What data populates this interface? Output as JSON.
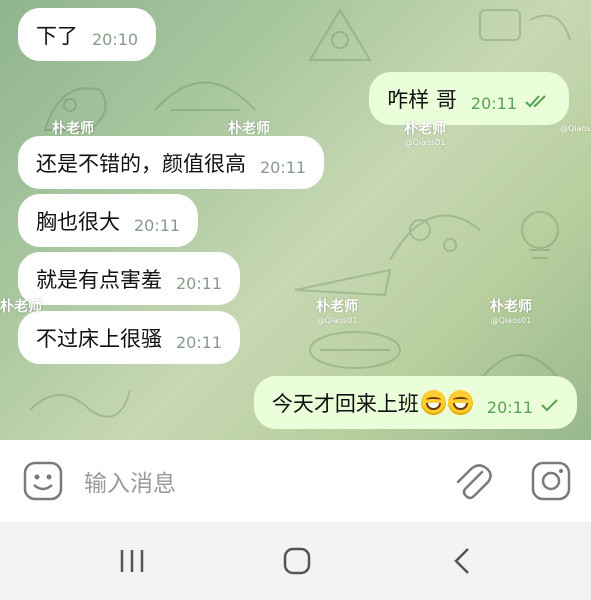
{
  "messages": [
    {
      "text": "下了",
      "time": "20:10",
      "direction": "incoming"
    },
    {
      "text": "咋样 哥",
      "time": "20:11",
      "direction": "outgoing",
      "status": "read"
    },
    {
      "text": "还是不错的，颜值很高",
      "time": "20:11",
      "direction": "incoming"
    },
    {
      "text": "胸也很大",
      "time": "20:11",
      "direction": "incoming"
    },
    {
      "text": "就是有点害羞",
      "time": "20:11",
      "direction": "incoming"
    },
    {
      "text": "不过床上很骚",
      "time": "20:11",
      "direction": "incoming"
    },
    {
      "text": "今天才回来上班",
      "time": "20:11",
      "direction": "outgoing",
      "status": "sent",
      "emoji": [
        "grinning-face",
        "grinning-face"
      ]
    }
  ],
  "watermark": {
    "name": "朴老师",
    "handle": "@Qiaos01"
  },
  "input": {
    "placeholder": "输入消息"
  },
  "icons": {
    "emoji_button": "smiley-icon",
    "attach_button": "paperclip-icon",
    "camera_button": "instagram-camera-icon",
    "nav_recent": "recent-apps-icon",
    "nav_home": "home-icon",
    "nav_back": "back-icon"
  },
  "colors": {
    "incoming_bubble": "#ffffff",
    "outgoing_bubble": "#eaffd9",
    "outgoing_time": "#59a152",
    "chat_background": "#a9c79f"
  }
}
